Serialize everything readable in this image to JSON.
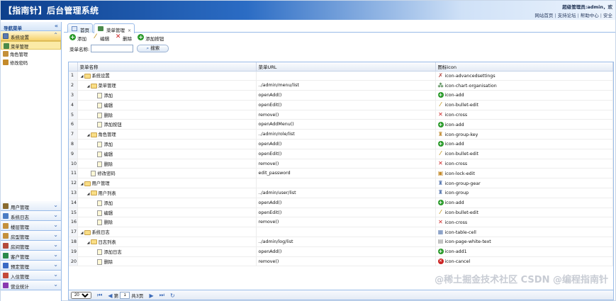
{
  "header": {
    "title": "【指南针】后台管理系统",
    "welcome_prefix": "超级管理员:admin，欢",
    "links": [
      "网站首页",
      "支持论坛",
      "帮助中心",
      "安全"
    ]
  },
  "sidebar": {
    "title": "导航菜单",
    "collapse_glyph": "«",
    "open_section": "系统设置",
    "open_items": [
      {
        "label": "菜单管理",
        "selected": true
      },
      {
        "label": "角色管理",
        "selected": false
      },
      {
        "label": "修改密码",
        "selected": false
      }
    ],
    "sections": [
      {
        "label": "用户管理",
        "color": "#8a6b2e"
      },
      {
        "label": "系统日志",
        "color": "#4a7cc4"
      },
      {
        "label": "楼层管理",
        "color": "#c4903a"
      },
      {
        "label": "房型管理",
        "color": "#c4903a"
      },
      {
        "label": "房间管理",
        "color": "#b44a3a"
      },
      {
        "label": "客户管理",
        "color": "#2a8a4a"
      },
      {
        "label": "预定管理",
        "color": "#3a6ac4"
      },
      {
        "label": "入住管理",
        "color": "#c44a3a"
      },
      {
        "label": "营业统计",
        "color": "#8a3ab0"
      }
    ]
  },
  "tabs": [
    {
      "label": "首页",
      "active": false,
      "closable": false
    },
    {
      "label": "菜单管理",
      "active": true,
      "closable": true
    }
  ],
  "toolbar": {
    "add": "添加",
    "edit": "编辑",
    "delete": "删除",
    "add_button": "添加按钮"
  },
  "search": {
    "label": "菜单名称:",
    "value": "",
    "button": "搜索"
  },
  "grid": {
    "columns": [
      "菜单名称",
      "菜单URL",
      "图标icon"
    ],
    "rows": [
      {
        "n": "1",
        "level": 0,
        "type": "folder",
        "name": "系统设置",
        "url": "",
        "icon": "icon-advancedsettings",
        "glyph": "✗",
        "color": "#b0403a"
      },
      {
        "n": "2",
        "level": 1,
        "type": "folder",
        "name": "菜单管理",
        "url": "../admin/menu/list",
        "icon": "icon-chart-organisation",
        "glyph": "⁂",
        "color": "#3a7a3a"
      },
      {
        "n": "3",
        "level": 2,
        "type": "doc",
        "name": "添加",
        "url": "openAdd()",
        "icon": "icon-add",
        "glyph": "+",
        "color": "#2a9a2a"
      },
      {
        "n": "4",
        "level": 2,
        "type": "doc",
        "name": "编辑",
        "url": "openEdit()",
        "icon": "icon-bullet-edit",
        "glyph": "⁄",
        "color": "#c49a2a"
      },
      {
        "n": "5",
        "level": 2,
        "type": "doc",
        "name": "删除",
        "url": "remove()",
        "icon": "icon-cross",
        "glyph": "✕",
        "color": "#cc2222"
      },
      {
        "n": "6",
        "level": 2,
        "type": "doc",
        "name": "添加按钮",
        "url": "openAddMenu()",
        "icon": "icon-add",
        "glyph": "+",
        "color": "#2a9a2a"
      },
      {
        "n": "7",
        "level": 1,
        "type": "folder",
        "name": "角色管理",
        "url": "../admin/role/list",
        "icon": "icon-group-key",
        "glyph": "♜",
        "color": "#c4903a"
      },
      {
        "n": "8",
        "level": 2,
        "type": "doc",
        "name": "添加",
        "url": "openAdd()",
        "icon": "icon-add",
        "glyph": "+",
        "color": "#2a9a2a"
      },
      {
        "n": "9",
        "level": 2,
        "type": "doc",
        "name": "编辑",
        "url": "openEdit()",
        "icon": "icon-bullet-edit",
        "glyph": "⁄",
        "color": "#c49a2a"
      },
      {
        "n": "10",
        "level": 2,
        "type": "doc",
        "name": "删除",
        "url": "remove()",
        "icon": "icon-cross",
        "glyph": "✕",
        "color": "#cc2222"
      },
      {
        "n": "11",
        "level": 1,
        "type": "doc",
        "name": "修改密码",
        "url": "edit_password",
        "icon": "icon-lock-edit",
        "glyph": "▣",
        "color": "#c48a2a"
      },
      {
        "n": "12",
        "level": 0,
        "type": "folder",
        "name": "用户管理",
        "url": "",
        "icon": "icon-group-gear",
        "glyph": "♜",
        "color": "#5a7ab0"
      },
      {
        "n": "13",
        "level": 1,
        "type": "folder",
        "name": "用户列表",
        "url": "../admin/user/list",
        "icon": "icon-group",
        "glyph": "♜",
        "color": "#5a7ab0"
      },
      {
        "n": "14",
        "level": 2,
        "type": "doc",
        "name": "添加",
        "url": "openAdd()",
        "icon": "icon-add",
        "glyph": "+",
        "color": "#2a9a2a"
      },
      {
        "n": "15",
        "level": 2,
        "type": "doc",
        "name": "编辑",
        "url": "openEdit()",
        "icon": "icon-bullet-edit",
        "glyph": "⁄",
        "color": "#c49a2a"
      },
      {
        "n": "16",
        "level": 2,
        "type": "doc",
        "name": "删除",
        "url": "remove()",
        "icon": "icon-cross",
        "glyph": "✕",
        "color": "#cc2222"
      },
      {
        "n": "17",
        "level": 0,
        "type": "folder",
        "name": "系统日志",
        "url": "",
        "icon": "icon-table-cell",
        "glyph": "▦",
        "color": "#5a7ab0"
      },
      {
        "n": "18",
        "level": 1,
        "type": "folder",
        "name": "日志列表",
        "url": "../admin/log/list",
        "icon": "icon-page-white-text",
        "glyph": "▤",
        "color": "#888888"
      },
      {
        "n": "19",
        "level": 2,
        "type": "doc",
        "name": "添加日志",
        "url": "openAdd()",
        "icon": "icon-add1",
        "glyph": "+",
        "color": "#2a9a2a"
      },
      {
        "n": "20",
        "level": 2,
        "type": "doc",
        "name": "删除",
        "url": "remove()",
        "icon": "icon-cancel",
        "glyph": "✕",
        "color": "#cc2222"
      }
    ]
  },
  "pager": {
    "page_size": "20",
    "page_prefix": "第",
    "page_value": "1",
    "page_suffix": "共3页"
  },
  "watermark": "@稀土掘金技术社区  CSDN @编程指南针"
}
